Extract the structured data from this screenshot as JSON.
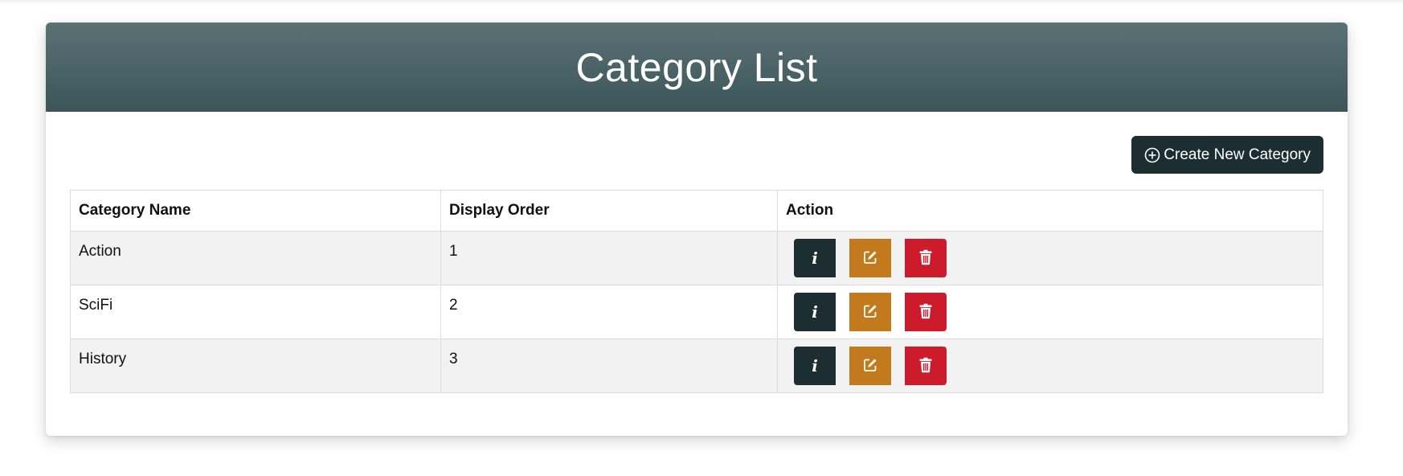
{
  "page": {
    "title": "Category List",
    "create_button_label": "Create New Category"
  },
  "table": {
    "headers": [
      "Category Name",
      "Display Order",
      "Action"
    ],
    "rows": [
      {
        "name": "Action",
        "order": "1"
      },
      {
        "name": "SciFi",
        "order": "2"
      },
      {
        "name": "History",
        "order": "3"
      }
    ],
    "action_icons": {
      "info": "info-icon",
      "edit": "edit-icon",
      "delete": "trash-icon"
    }
  },
  "colors": {
    "header_gradient_top": "#5b7275",
    "header_gradient_bottom": "#3b5558",
    "primary_dark": "#1c2e32",
    "edit": "#c27a1d",
    "delete": "#cc1c2c"
  }
}
